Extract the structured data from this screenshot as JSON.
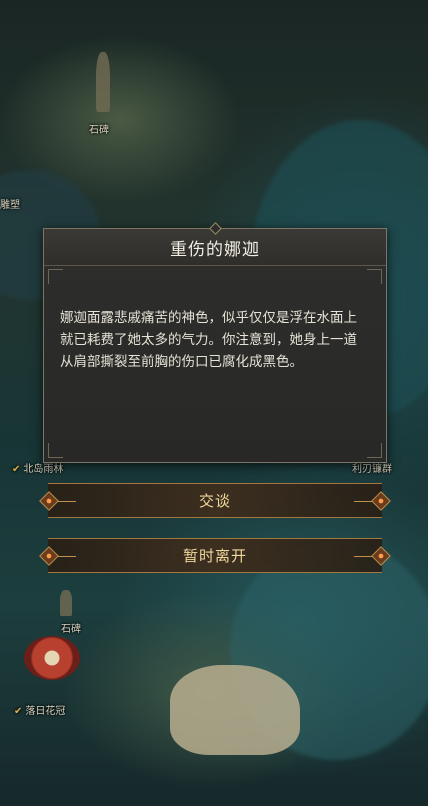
{
  "map": {
    "labels": {
      "stone_tablet_top": "石碑",
      "left_edge": "雕塑",
      "north_island_rainforest": "北岛雨林",
      "right_group": "利刃镰群",
      "stone_tablet_bottom": "石碑",
      "sunset_flower_crown": "落日花冠"
    }
  },
  "dialog": {
    "title": "重伤的娜迦",
    "body": "娜迦面露悲戚痛苦的神色，似乎仅仅是浮在水面上就已耗费了她太多的气力。你注意到，她身上一道从肩部撕裂至前胸的伤口已腐化成黑色。"
  },
  "choices": [
    {
      "label": "交谈"
    },
    {
      "label": "暂时离开"
    }
  ]
}
